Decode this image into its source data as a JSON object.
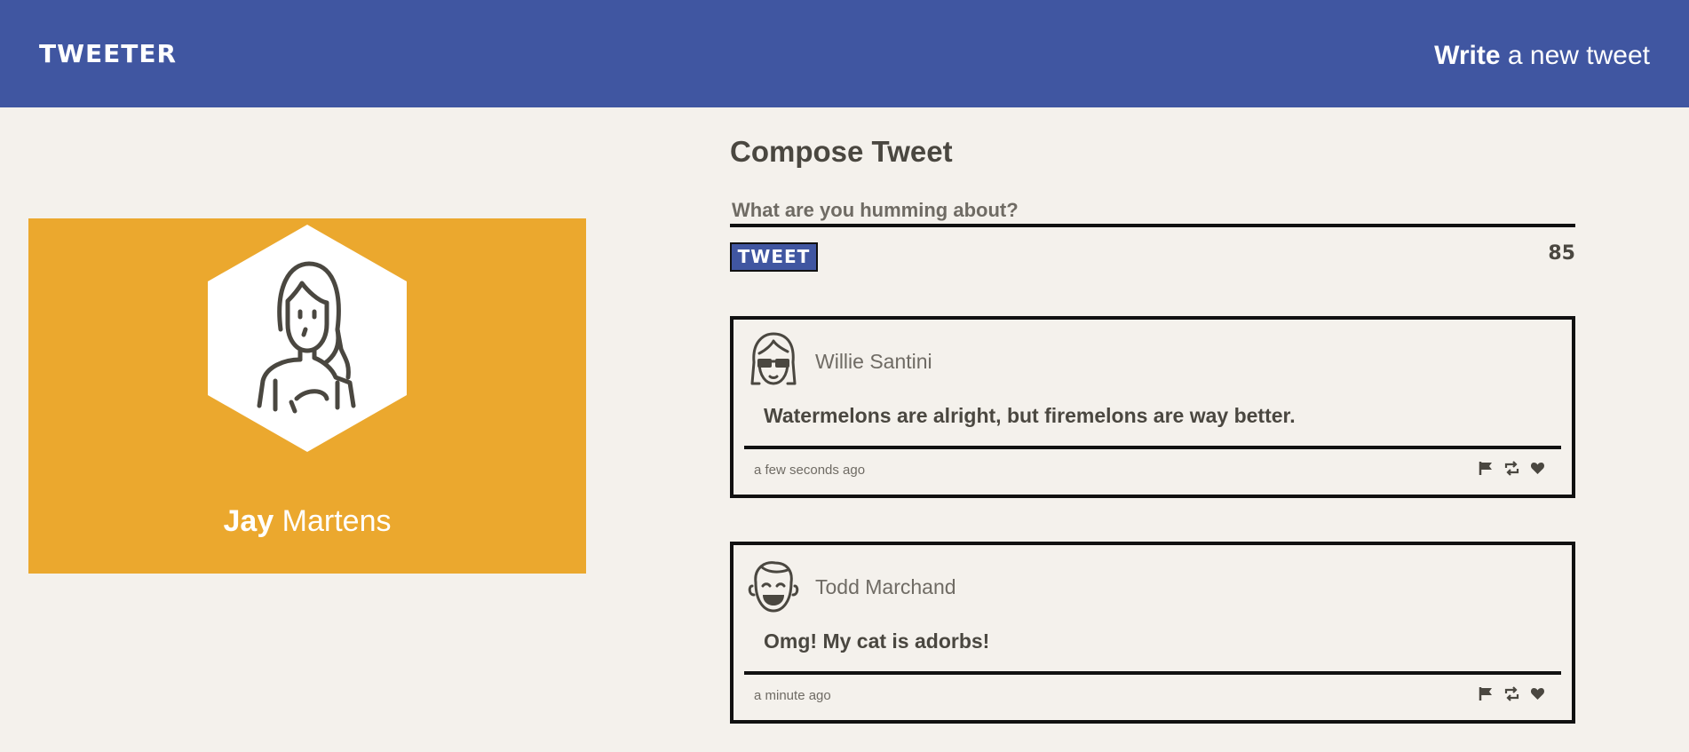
{
  "header": {
    "brand": "TWEETER",
    "write_strong": "Write",
    "write_rest": " a new tweet"
  },
  "profile": {
    "first_name": "Jay",
    "last_name": " Martens",
    "avatar_icon": "woman-avatar-icon"
  },
  "compose": {
    "title": "Compose Tweet",
    "placeholder": "What are you humming about?",
    "button_label": "TWEET",
    "counter": "85"
  },
  "tweets": [
    {
      "author": "Willie Santini",
      "avatar_icon": "sunglasses-avatar-icon",
      "text": "Watermelons are alright, but firemelons are way better.",
      "time": "a few seconds ago",
      "actions": [
        "flag-icon",
        "retweet-icon",
        "heart-icon"
      ]
    },
    {
      "author": "Todd Marchand",
      "avatar_icon": "smiling-man-avatar-icon",
      "text": "Omg! My cat is adorbs!",
      "time": "a minute ago",
      "actions": [
        "flag-icon",
        "retweet-icon",
        "heart-icon"
      ]
    }
  ],
  "colors": {
    "header_bg": "#4056a1",
    "page_bg": "#f4f1ec",
    "profile_bg": "#eba82e",
    "text_dark": "#4a4740"
  }
}
